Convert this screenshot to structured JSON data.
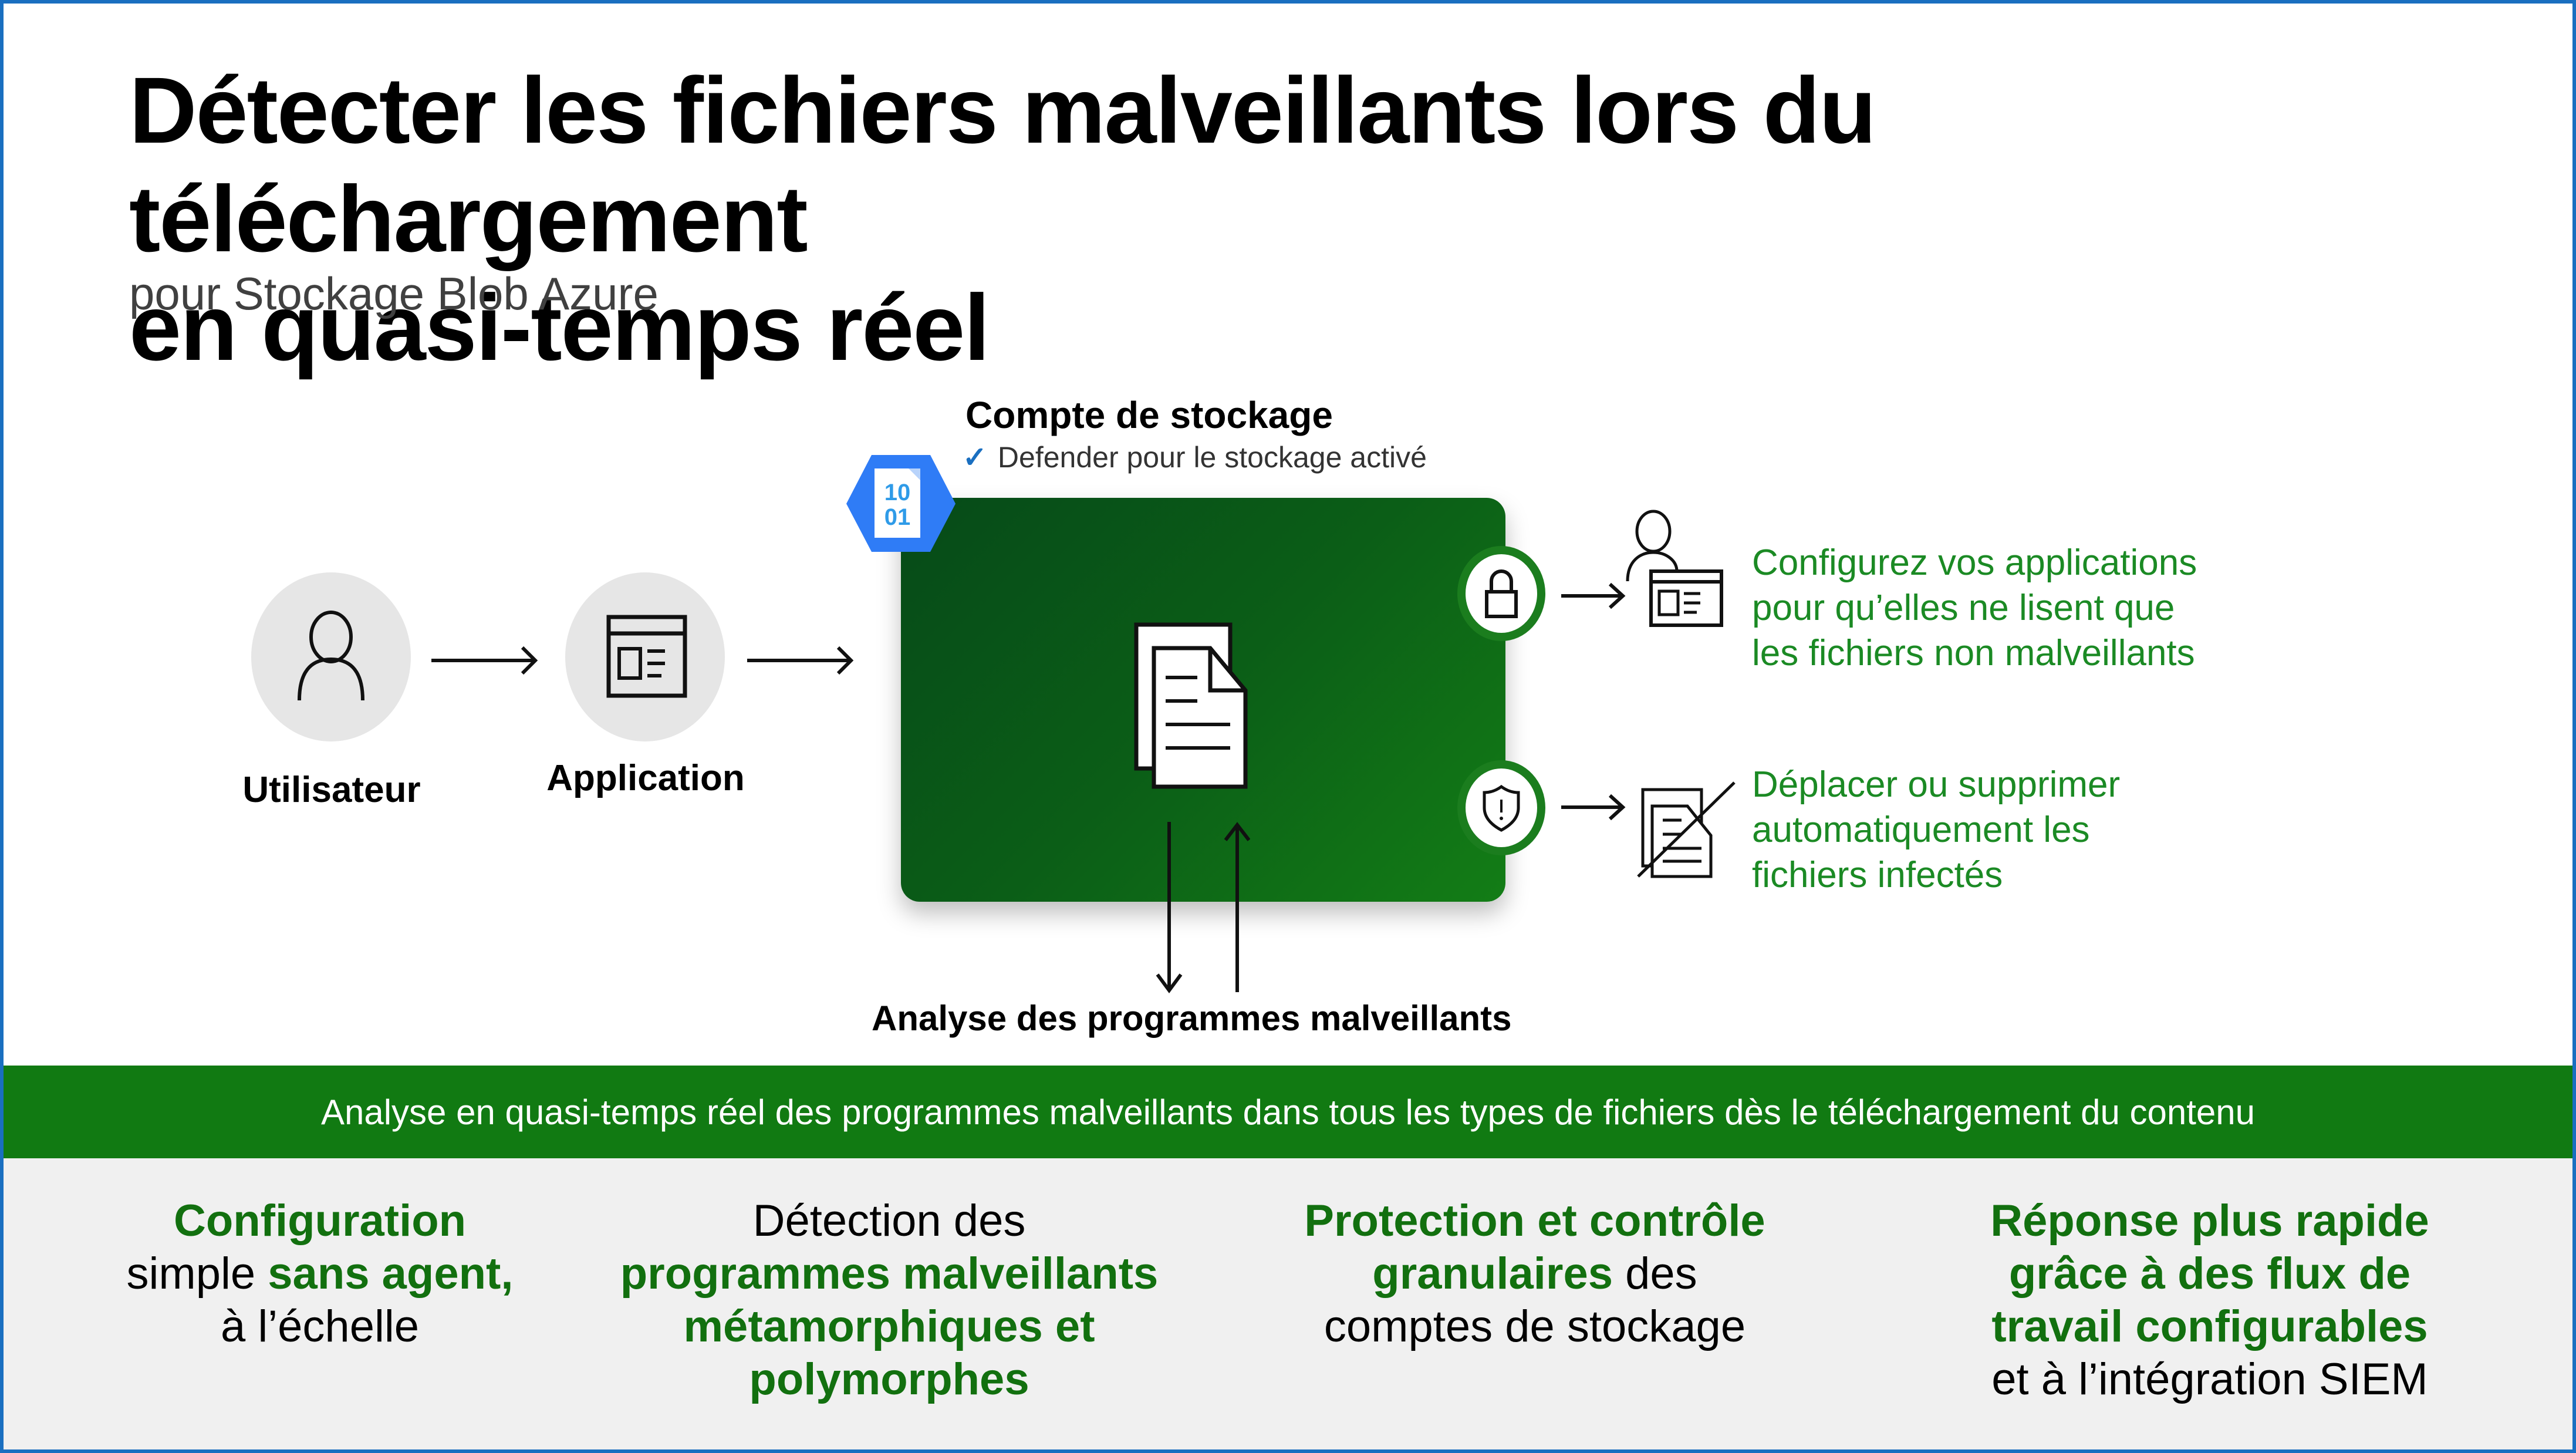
{
  "title": {
    "line1": "Détecter les fichiers malveillants lors du téléchargement",
    "line2": "en quasi-temps réel",
    "subtitle": "pour Stockage Blob Azure"
  },
  "flow": {
    "user_label": "Utilisateur",
    "app_label": "Application",
    "user_icon": "person-icon",
    "app_icon": "application-window-icon"
  },
  "storage_account": {
    "title": "Compte de stockage",
    "status": "Defender pour le stockage activé",
    "status_icon": "checkmark-icon",
    "icon": "blob-storage-icon",
    "icon_text_1": "10",
    "icon_text_2": "01",
    "center_icon": "documents-icon",
    "scan_label": "Analyse des programmes malveillants"
  },
  "outcomes": [
    {
      "icon": "lock-icon",
      "target_icon": "user-application-icon",
      "text_lines": [
        "Configurez vos applications",
        "pour qu’elles ne lisent que",
        "les fichiers non malveillants"
      ]
    },
    {
      "icon": "shield-alert-icon",
      "target_icon": "deleted-document-icon",
      "text_lines": [
        "Déplacer ou supprimer",
        "automatiquement les",
        "fichiers infectés"
      ]
    }
  ],
  "band": {
    "text": "Analyse en quasi-temps réel des programmes malveillants dans tous les types de fichiers dès le téléchargement du contenu"
  },
  "features": [
    {
      "parts": [
        {
          "text": "Configuration",
          "accent": true,
          "br": true
        },
        {
          "text": "simple ",
          "accent": false
        },
        {
          "text": " sans agent,",
          "accent": true,
          "br": true
        },
        {
          "text": "à l’échelle",
          "accent": false
        }
      ]
    },
    {
      "parts": [
        {
          "text": "Détection des",
          "accent": false,
          "br": true
        },
        {
          "text": "programmes malveillants",
          "accent": true,
          "br": true
        },
        {
          "text": "métamorphiques et",
          "accent": true,
          "br": true
        },
        {
          "text": "polymorphes",
          "accent": true
        }
      ]
    },
    {
      "parts": [
        {
          "text": "Protection et contrôle",
          "accent": true,
          "br": true
        },
        {
          "text": "granulaires",
          "accent": true
        },
        {
          "text": " des",
          "accent": false,
          "br": true
        },
        {
          "text": "comptes de stockage",
          "accent": false
        }
      ]
    },
    {
      "parts": [
        {
          "text": "Réponse plus rapide",
          "accent": true,
          "br": true
        },
        {
          "text": "grâce à des flux de",
          "accent": true,
          "br": true
        },
        {
          "text": "travail configurables",
          "accent": true,
          "br": true
        },
        {
          "text": "et à l’intégration SIEM",
          "accent": false
        }
      ]
    }
  ],
  "colors": {
    "accent_green": "#12700f",
    "band_green": "#117a12",
    "outcome_text_green": "#1b8a24",
    "border_blue": "#1a6fc0",
    "storage_icon_blue": "#2f7cf6"
  }
}
